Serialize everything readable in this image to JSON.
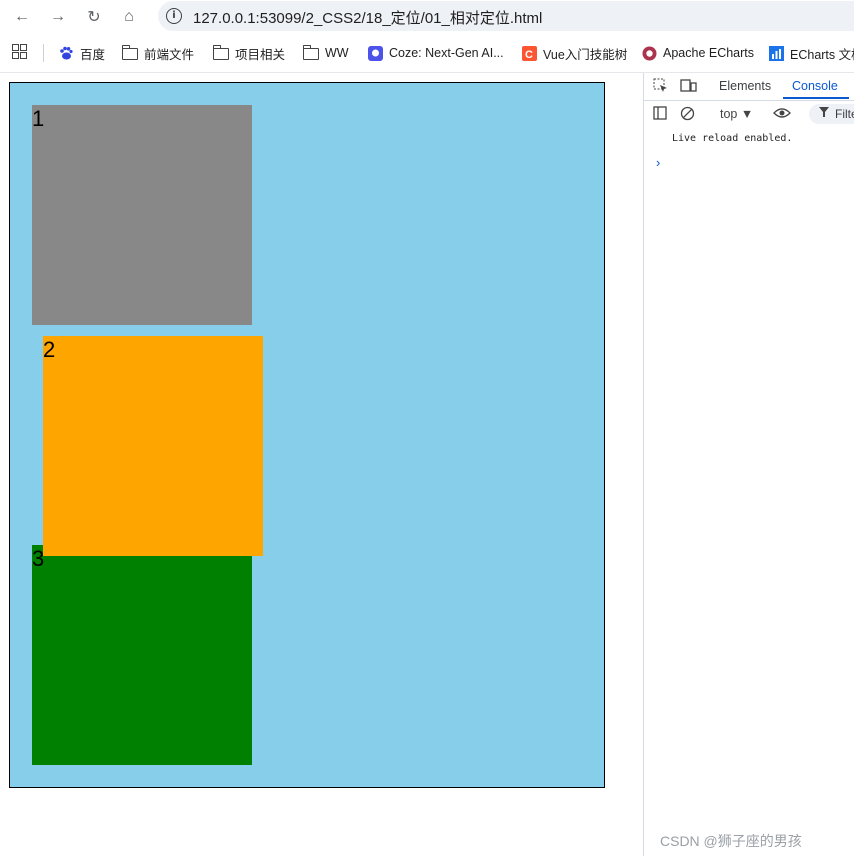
{
  "browser": {
    "url": "127.0.0.1:53099/2_CSS2/18_定位/01_相对定位.html",
    "nav": {
      "back": "←",
      "forward": "→",
      "reload": "↻",
      "home": "⌂",
      "info": "i"
    },
    "bookmarks": [
      {
        "label": "百度",
        "icon": "baidu-icon"
      },
      {
        "label": "前端文件",
        "icon": "folder-icon"
      },
      {
        "label": "项目相关",
        "icon": "folder-icon"
      },
      {
        "label": "WW",
        "icon": "folder-icon"
      },
      {
        "label": "Coze: Next-Gen AI...",
        "icon": "coze-icon"
      },
      {
        "label": "Vue入门技能树",
        "icon": "csdn-icon"
      },
      {
        "label": "Apache ECharts",
        "icon": "echarts-icon"
      },
      {
        "label": "ECharts 文档",
        "icon": "echarts-doc-icon"
      }
    ]
  },
  "page": {
    "boxes": [
      {
        "label": "1",
        "color": "#888888"
      },
      {
        "label": "2",
        "color": "#ffa500"
      },
      {
        "label": "3",
        "color": "#008000"
      }
    ],
    "container_color": "#87ceeb"
  },
  "devtools": {
    "tabs": [
      "Elements",
      "Console"
    ],
    "active_tab": "Console",
    "context": "top ▼",
    "filter": "Filter",
    "console_lines": [
      "Live reload enabled."
    ],
    "prompt": "›"
  },
  "watermark": "CSDN @狮子座的男孩"
}
